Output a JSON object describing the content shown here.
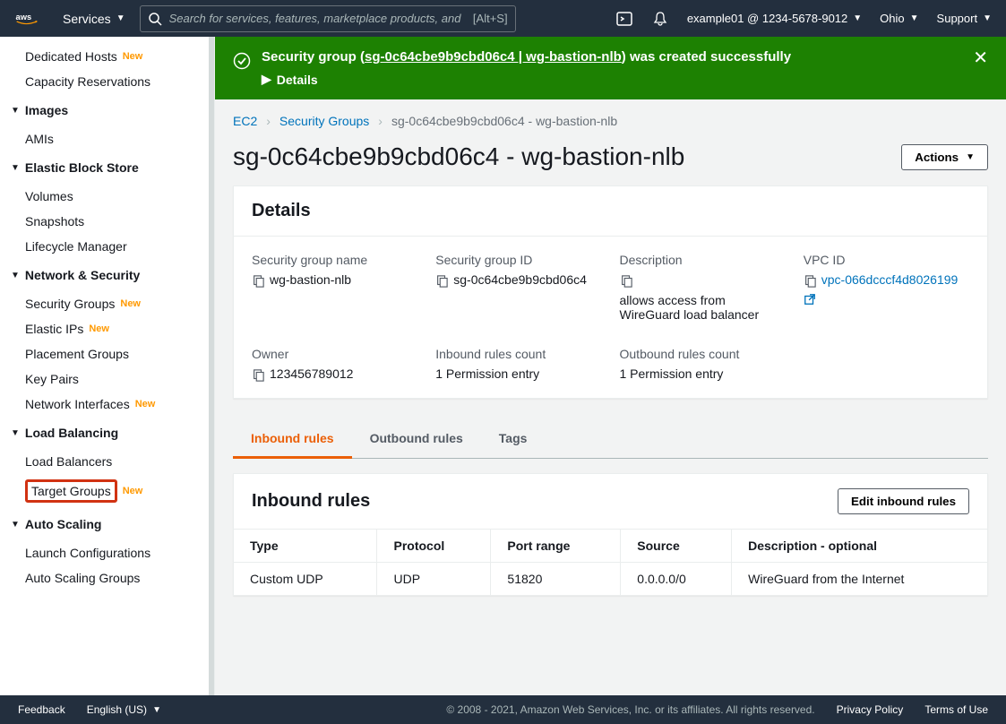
{
  "topnav": {
    "services_label": "Services",
    "search_placeholder": "Search for services, features, marketplace products, and",
    "search_shortcut": "[Alt+S]",
    "account": "example01 @ 1234-5678-9012",
    "region": "Ohio",
    "support": "Support"
  },
  "sidebar": {
    "dedicated_hosts": "Dedicated Hosts",
    "capacity_reservations": "Capacity Reservations",
    "images_head": "Images",
    "amis": "AMIs",
    "ebs_head": "Elastic Block Store",
    "volumes": "Volumes",
    "snapshots": "Snapshots",
    "lifecycle": "Lifecycle Manager",
    "netsec_head": "Network & Security",
    "security_groups": "Security Groups",
    "elastic_ips": "Elastic IPs",
    "placement_groups": "Placement Groups",
    "key_pairs": "Key Pairs",
    "network_interfaces": "Network Interfaces",
    "lb_head": "Load Balancing",
    "load_balancers": "Load Balancers",
    "target_groups": "Target Groups",
    "as_head": "Auto Scaling",
    "launch_configs": "Launch Configurations",
    "asg": "Auto Scaling Groups",
    "new_badge": "New"
  },
  "flash": {
    "prefix": "Security group (",
    "link": "sg-0c64cbe9b9cbd06c4 | wg-bastion-nlb",
    "suffix": ") was created successfully",
    "details": "Details"
  },
  "breadcrumbs": {
    "ec2": "EC2",
    "sg": "Security Groups",
    "current": "sg-0c64cbe9b9cbd06c4 - wg-bastion-nlb"
  },
  "page": {
    "title": "sg-0c64cbe9b9cbd06c4 - wg-bastion-nlb",
    "actions": "Actions"
  },
  "details": {
    "heading": "Details",
    "name_label": "Security group name",
    "name_value": "wg-bastion-nlb",
    "id_label": "Security group ID",
    "id_value": "sg-0c64cbe9b9cbd06c4",
    "desc_label": "Description",
    "desc_value": "allows access from WireGuard load balancer",
    "vpc_label": "VPC ID",
    "vpc_value": "vpc-066dcccf4d8026199",
    "owner_label": "Owner",
    "owner_value": "123456789012",
    "inbound_count_label": "Inbound rules count",
    "inbound_count_value": "1 Permission entry",
    "outbound_count_label": "Outbound rules count",
    "outbound_count_value": "1 Permission entry"
  },
  "tabs": {
    "inbound": "Inbound rules",
    "outbound": "Outbound rules",
    "tags": "Tags"
  },
  "inbound_panel": {
    "heading": "Inbound rules",
    "edit_btn": "Edit inbound rules",
    "cols": {
      "type": "Type",
      "protocol": "Protocol",
      "port": "Port range",
      "source": "Source",
      "desc": "Description - optional"
    },
    "row": {
      "type": "Custom UDP",
      "protocol": "UDP",
      "port": "51820",
      "source": "0.0.0.0/0",
      "desc": "WireGuard from the Internet"
    }
  },
  "footer": {
    "feedback": "Feedback",
    "language": "English (US)",
    "copyright": "© 2008 - 2021, Amazon Web Services, Inc. or its affiliates. All rights reserved.",
    "privacy": "Privacy Policy",
    "terms": "Terms of Use"
  }
}
